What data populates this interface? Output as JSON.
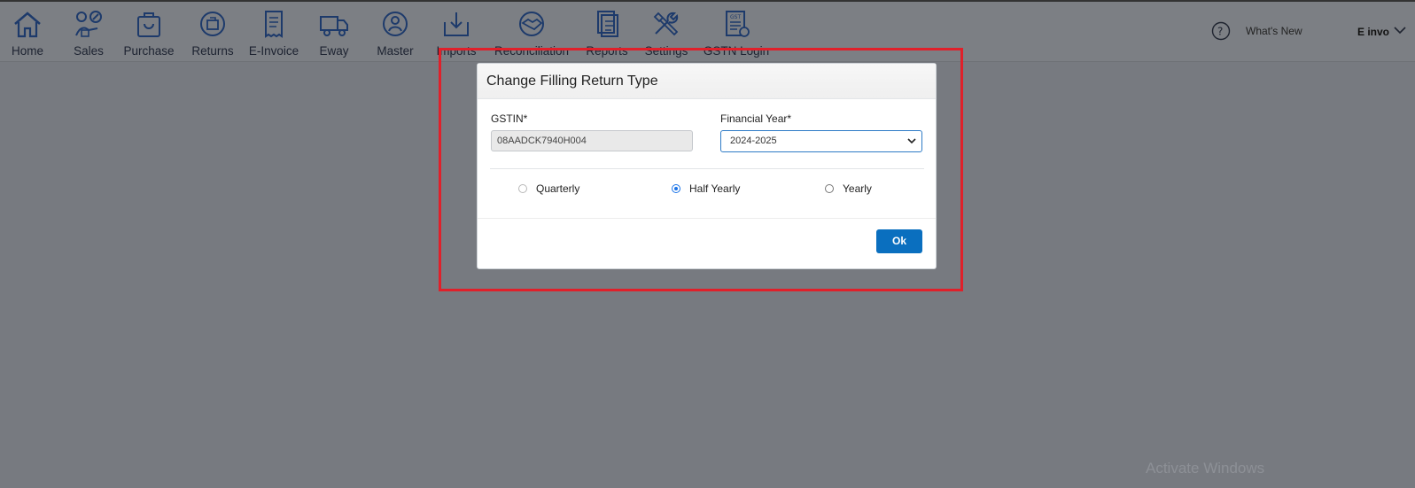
{
  "toolbar": {
    "items": [
      {
        "label": "Home",
        "icon": "home-icon"
      },
      {
        "label": "Sales",
        "icon": "sales-icon"
      },
      {
        "label": "Purchase",
        "icon": "purchase-icon"
      },
      {
        "label": "Returns",
        "icon": "returns-icon"
      },
      {
        "label": "E-Invoice",
        "icon": "invoice-icon"
      },
      {
        "label": "Eway",
        "icon": "truck-icon"
      },
      {
        "label": "Master",
        "icon": "master-icon"
      },
      {
        "label": "Imports",
        "icon": "import-icon"
      },
      {
        "label": "Reconciliation",
        "icon": "handshake-icon"
      },
      {
        "label": "Reports",
        "icon": "reports-icon"
      },
      {
        "label": "Settings",
        "icon": "tools-icon"
      },
      {
        "label": "GSTN Login",
        "icon": "gst-icon"
      }
    ],
    "whats_new": "What's New",
    "user_label": "E invoice"
  },
  "modal": {
    "title": "Change Filling Return Type",
    "gstin_label": "GSTIN*",
    "gstin_value": "08AADCK7940H004",
    "fy_label": "Financial Year*",
    "fy_value": "2024-2025",
    "options": [
      {
        "label": "Quarterly",
        "checked": false
      },
      {
        "label": "Half Yearly",
        "checked": true
      },
      {
        "label": "Yearly",
        "checked": false
      }
    ],
    "ok_label": "Ok"
  },
  "overlay_text": "Activate Windows",
  "colors": {
    "accent": "#0a6fbf",
    "highlight_box": "#e0202a",
    "overlay": "#777a80"
  }
}
